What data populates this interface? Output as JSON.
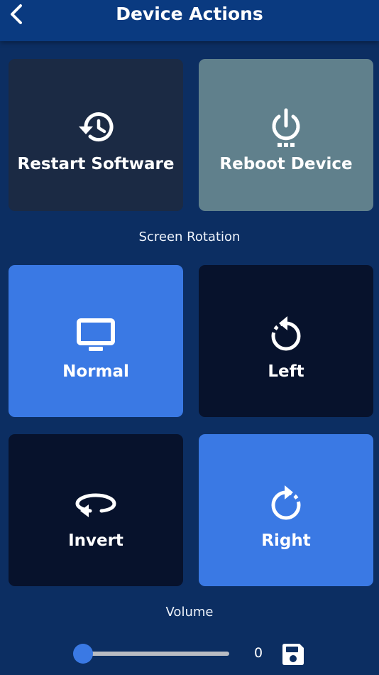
{
  "header": {
    "title": "Device Actions",
    "back_icon": "chevron-left-icon"
  },
  "actions": [
    {
      "label": "Restart Software",
      "icon": "history-icon",
      "color": "#1b2a44"
    },
    {
      "label": "Reboot Device",
      "icon": "power-icon",
      "color": "#60808c"
    }
  ],
  "rotation": {
    "section_label": "Screen Rotation",
    "options": [
      {
        "label": "Normal",
        "icon": "monitor-icon",
        "selected": true
      },
      {
        "label": "Left",
        "icon": "rotate-left-icon",
        "selected": false
      },
      {
        "label": "Invert",
        "icon": "rotate-invert-icon",
        "selected": false
      },
      {
        "label": "Right",
        "icon": "rotate-right-icon",
        "selected": true
      }
    ],
    "selected_color": "#3a79e4",
    "unselected_color": "#07122c"
  },
  "volume": {
    "section_label": "Volume",
    "value": "0",
    "save_icon": "save-icon"
  }
}
